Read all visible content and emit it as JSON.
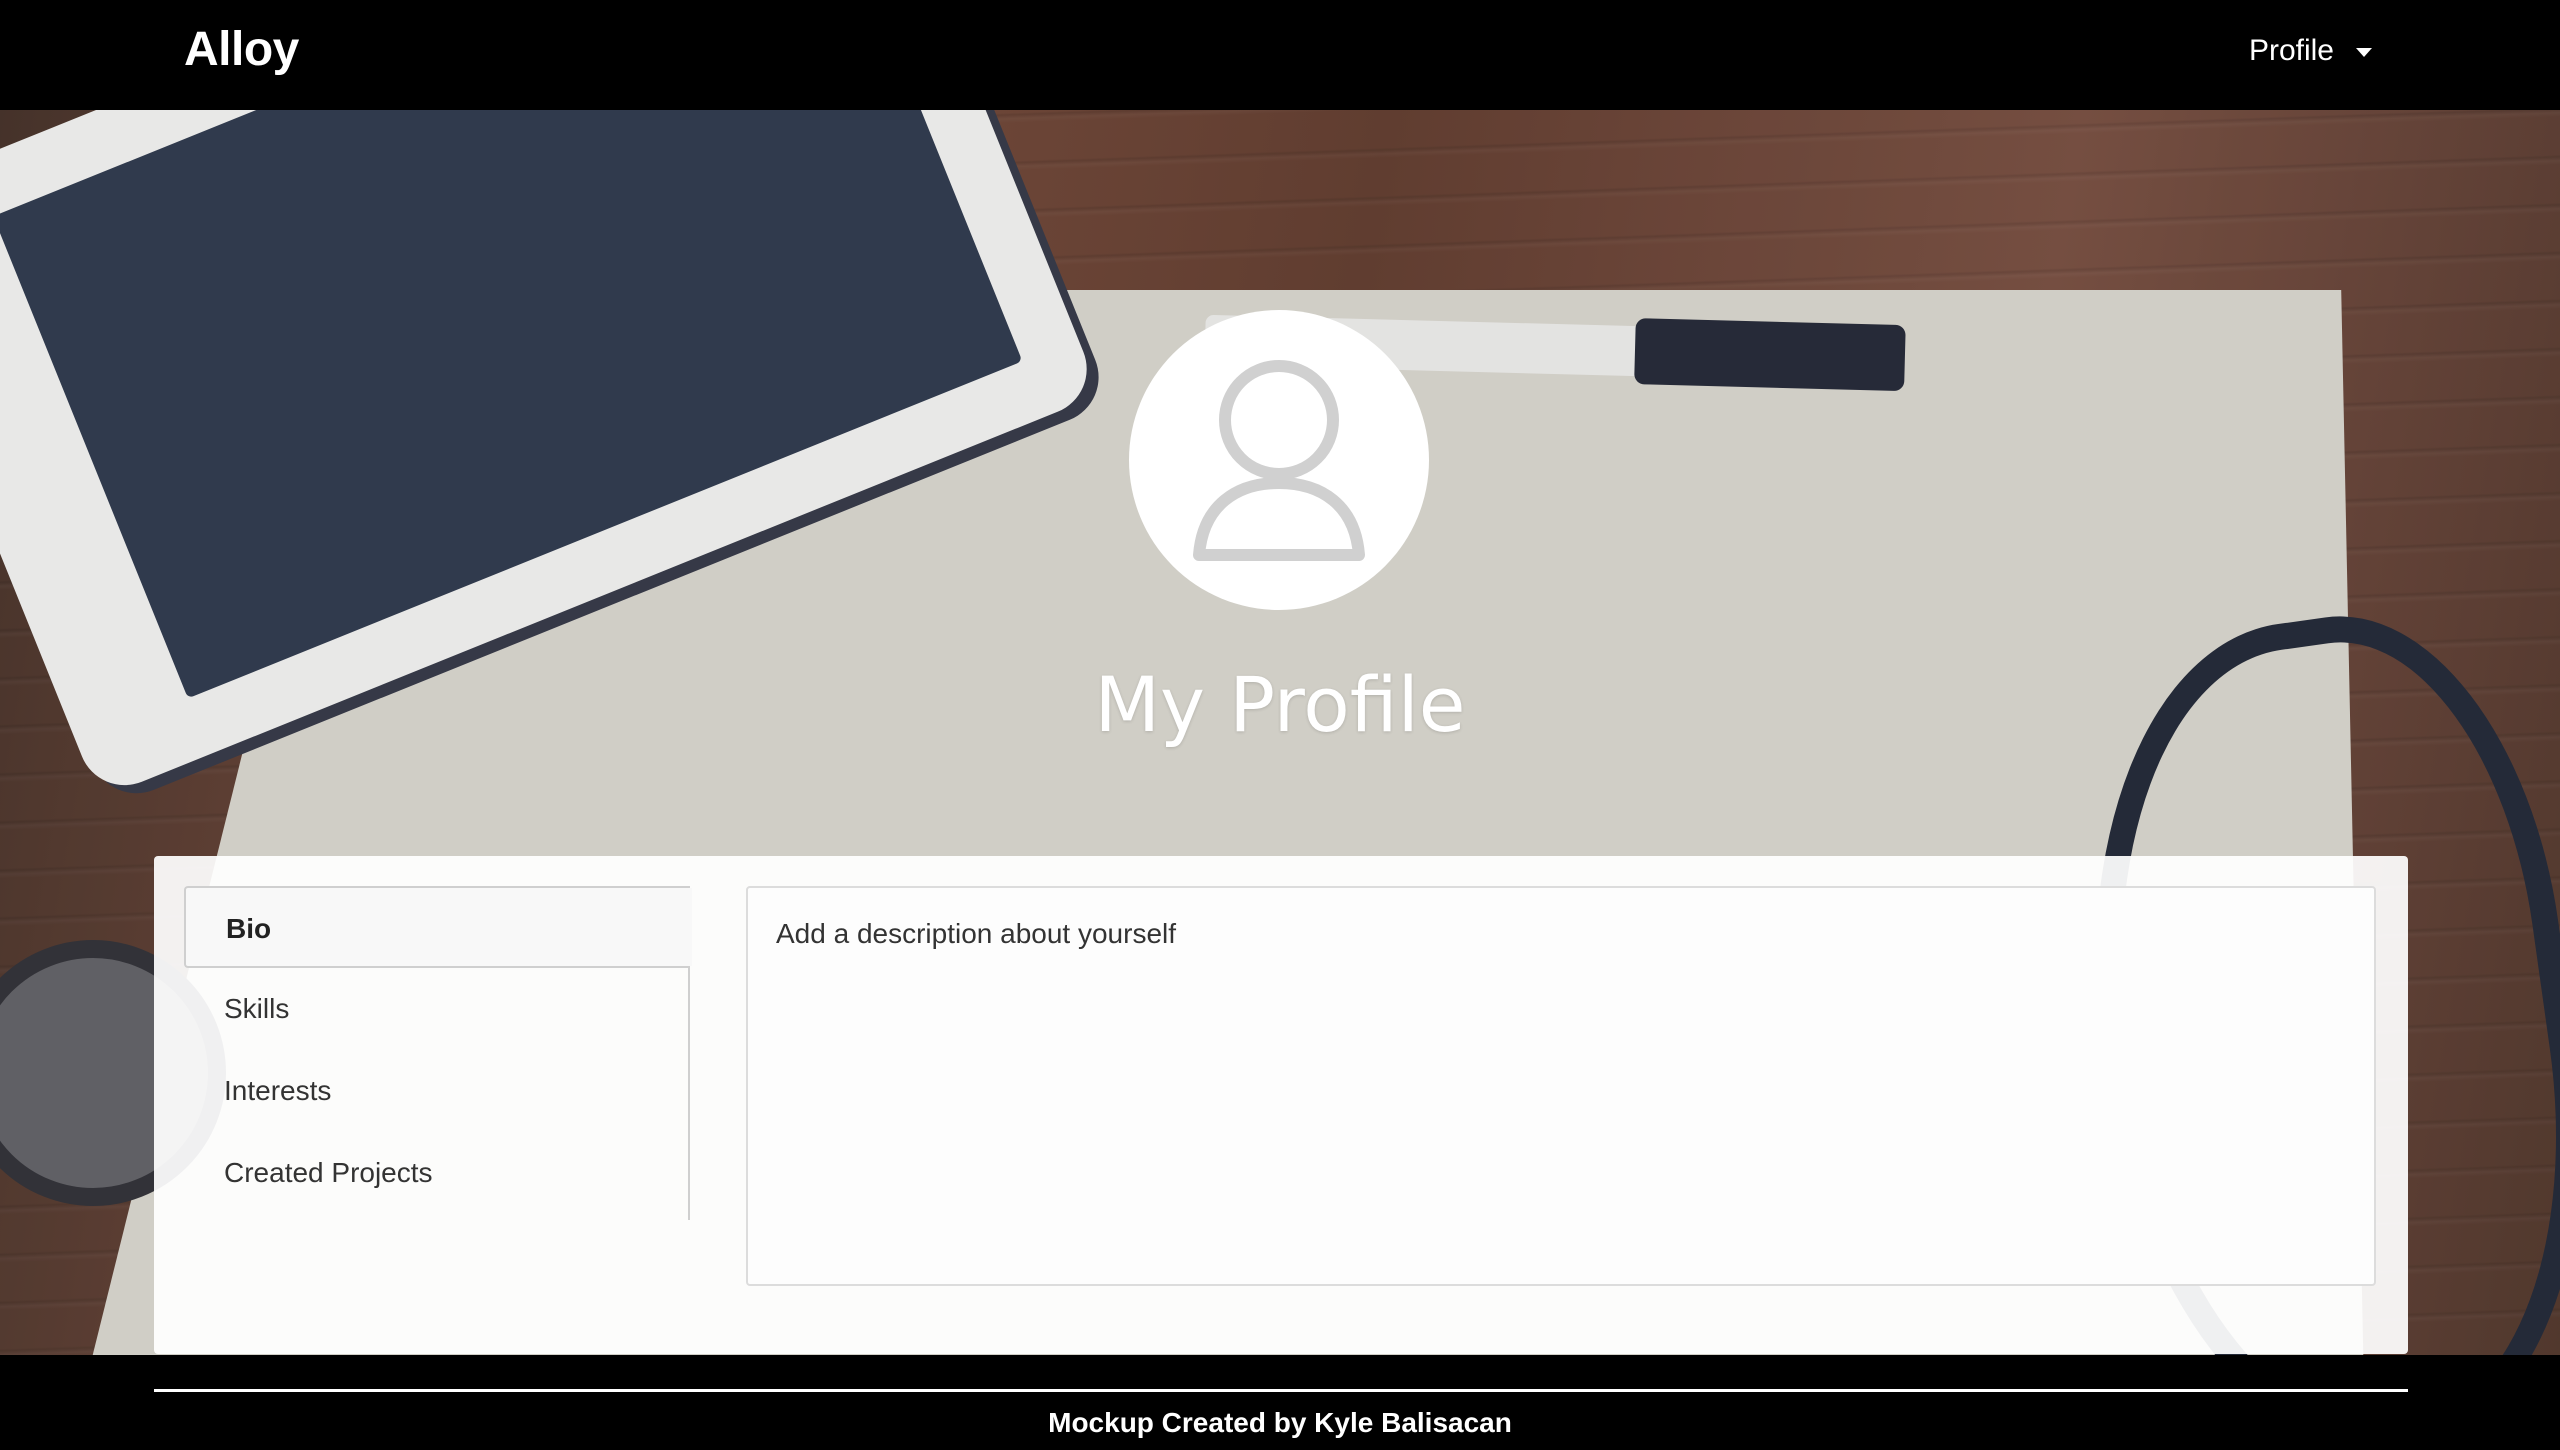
{
  "navbar": {
    "brand": "Alloy",
    "profile_menu_label": "Profile"
  },
  "hero": {
    "title": "My Profile"
  },
  "profile_tabs": [
    {
      "label": "Bio",
      "active": true
    },
    {
      "label": "Skills",
      "active": false
    },
    {
      "label": "Interests",
      "active": false
    },
    {
      "label": "Created Projects",
      "active": false
    }
  ],
  "bio": {
    "placeholder": "Add a description about yourself",
    "value": ""
  },
  "footer": {
    "credit": "Mockup Created by Kyle Balisacan"
  },
  "icons": {
    "avatar": "user-avatar-icon",
    "profile_menu": "chevron-down-icon"
  },
  "colors": {
    "navbar_bg": "#000000",
    "panel_bg": "#ffffff",
    "text": "#333333",
    "avatar_glyph": "#d0d0d0"
  }
}
